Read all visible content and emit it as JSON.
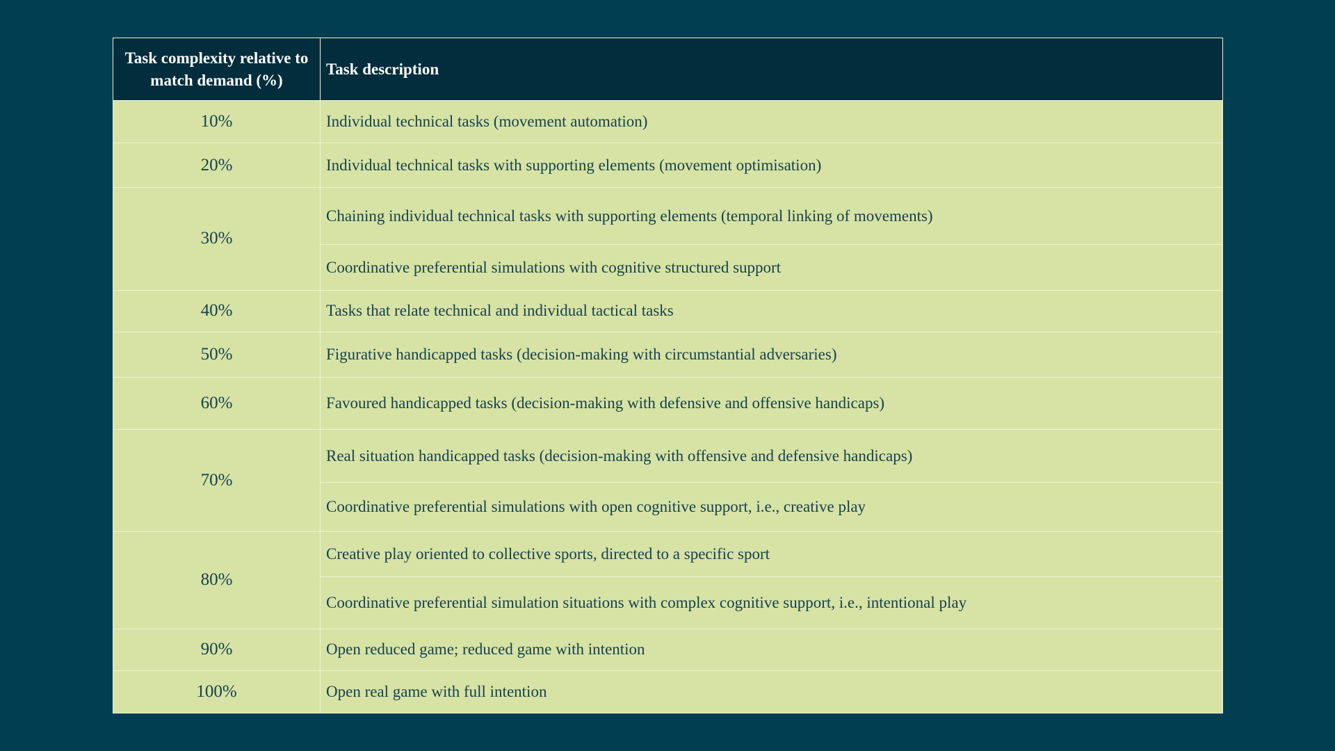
{
  "table": {
    "headers": {
      "complexity": "Task complexity relative to match demand (%)",
      "description": "Task description"
    },
    "rows": [
      {
        "pct": "10%",
        "descriptions": [
          "Individual technical tasks (movement automation)"
        ]
      },
      {
        "pct": "20%",
        "descriptions": [
          "Individual technical tasks with supporting elements (movement optimisation)"
        ]
      },
      {
        "pct": "30%",
        "descriptions": [
          "Chaining individual technical tasks with supporting elements (temporal linking of movements)",
          "Coordinative preferential simulations with cognitive structured support"
        ]
      },
      {
        "pct": "40%",
        "descriptions": [
          "Tasks that relate technical and individual tactical tasks"
        ]
      },
      {
        "pct": "50%",
        "descriptions": [
          "Figurative handicapped tasks (decision-making with circumstantial adversaries)"
        ]
      },
      {
        "pct": "60%",
        "descriptions": [
          "Favoured handicapped tasks (decision-making with defensive and offensive handicaps)"
        ]
      },
      {
        "pct": "70%",
        "descriptions": [
          "Real situation handicapped tasks (decision-making with offensive and defensive handicaps)",
          "Coordinative preferential simulations with open cognitive support, i.e., creative play"
        ]
      },
      {
        "pct": "80%",
        "descriptions": [
          "Creative play oriented to collective sports, directed to a specific sport",
          "Coordinative preferential simulation situations with complex cognitive support, i.e., intentional play"
        ]
      },
      {
        "pct": "90%",
        "descriptions": [
          "Open reduced game; reduced game with intention"
        ]
      },
      {
        "pct": "100%",
        "descriptions": [
          "Open real game with full intention"
        ]
      }
    ]
  },
  "colors": {
    "background": "#003f52",
    "header_bg": "#022d3d",
    "cell_bg": "#d7e3a4",
    "cell_text": "#163f4f",
    "border": "#eef2d8"
  }
}
